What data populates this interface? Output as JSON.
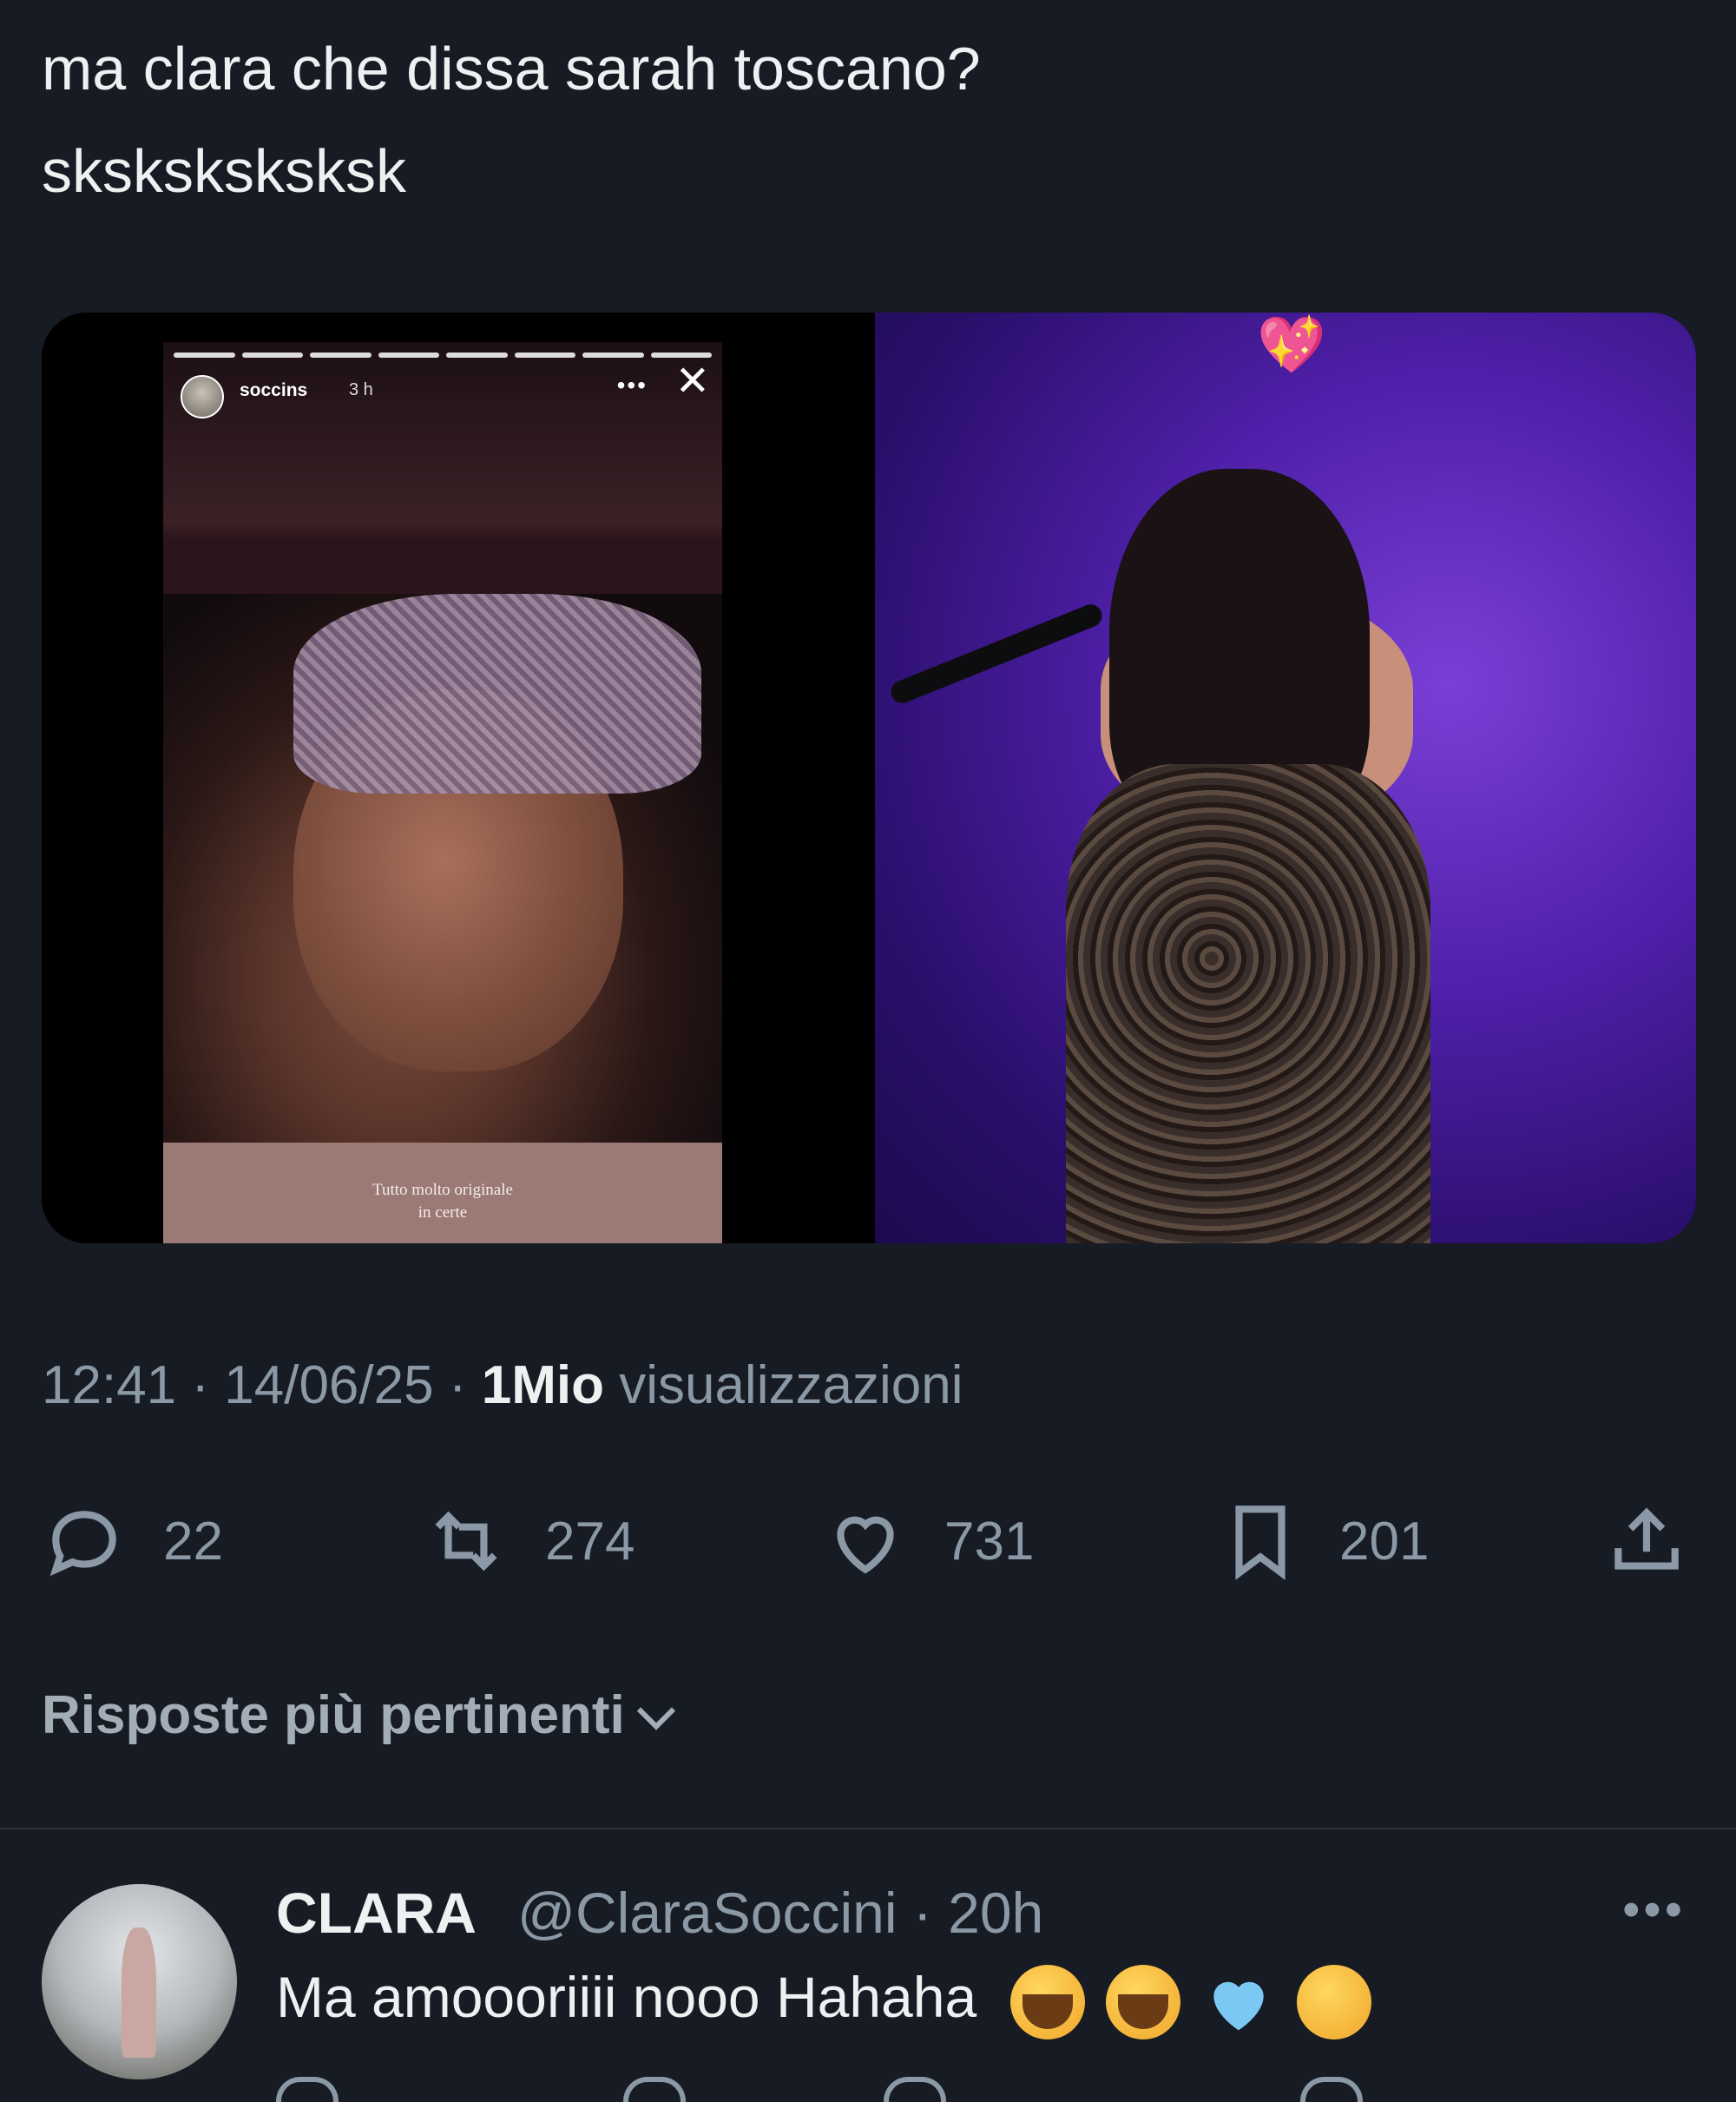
{
  "tweet": {
    "text": "ma clara che dissa sarah toscano?\nsksksksksksk"
  },
  "media": {
    "story": {
      "username": "soccins",
      "time": "3 h",
      "caption": "Tutto molto originale\nin certe"
    }
  },
  "meta": {
    "time": "12:41",
    "date": "14/06/25",
    "views_count": "1Mio",
    "views_label": "visualizzazioni"
  },
  "actions": {
    "replies": "22",
    "reposts": "274",
    "likes": "731",
    "bookmarks": "201"
  },
  "sort": {
    "label": "Risposte più pertinenti"
  },
  "reply": {
    "name": "CLARA",
    "handle": "@ClaraSoccini · 20h",
    "text": "Ma amoooriiii nooo Hahaha"
  },
  "colors": {
    "background": "#161b24",
    "muted": "#8b98a5",
    "text": "#e7e9ea"
  }
}
